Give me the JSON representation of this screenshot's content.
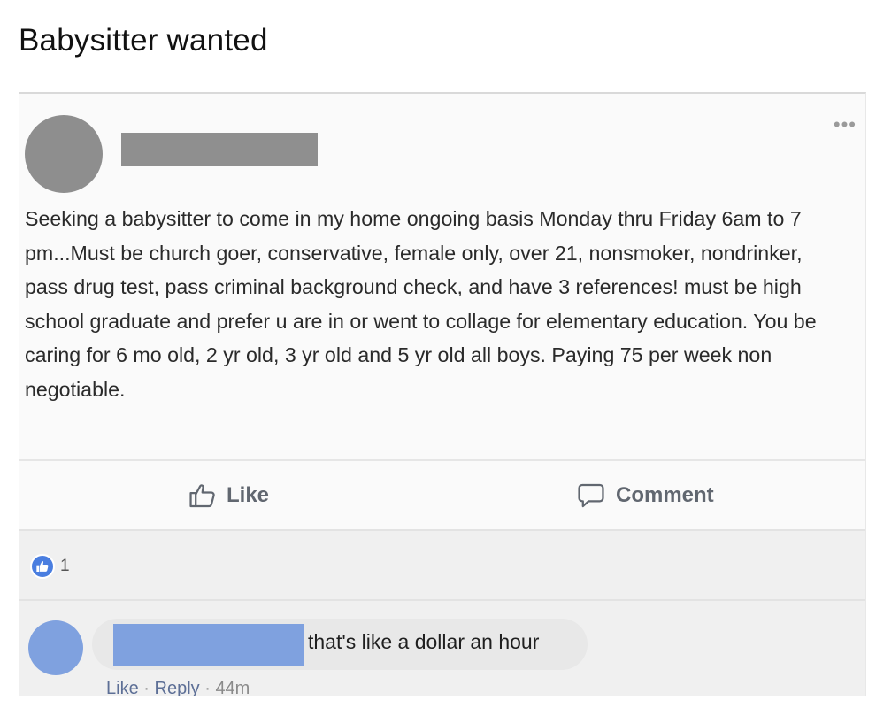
{
  "page": {
    "heading": "Babysitter wanted"
  },
  "post": {
    "more_menu": "•••",
    "text": "Seeking a babysitter to come in my home ongoing basis Monday thru Friday 6am to 7 pm...Must be church goer, conservative, female only, over 21, nonsmoker, nondrinker, pass drug test, pass criminal background check, and have 3 references! must be high school graduate and prefer u are in or went to collage for elementary education. You be caring for 6 mo old, 2 yr old, 3 yr old and 5 yr old all boys. Paying 75 per week non negotiable.",
    "actions": {
      "like_label": "Like",
      "comment_label": "Comment"
    },
    "reactions": {
      "count": "1"
    }
  },
  "comment": {
    "text": "that's like a dollar an hour",
    "like_label": "Like",
    "separator": "·",
    "reply_label": "Reply",
    "time": "44m"
  },
  "colors": {
    "accent_blue": "#4a7ee0",
    "redaction_gray": "#8f8f8f",
    "redaction_blue": "#7fa1df"
  },
  "icons": {
    "like": "thumbs-up-icon",
    "comment": "speech-bubble-icon",
    "reaction": "like-reaction-icon"
  }
}
